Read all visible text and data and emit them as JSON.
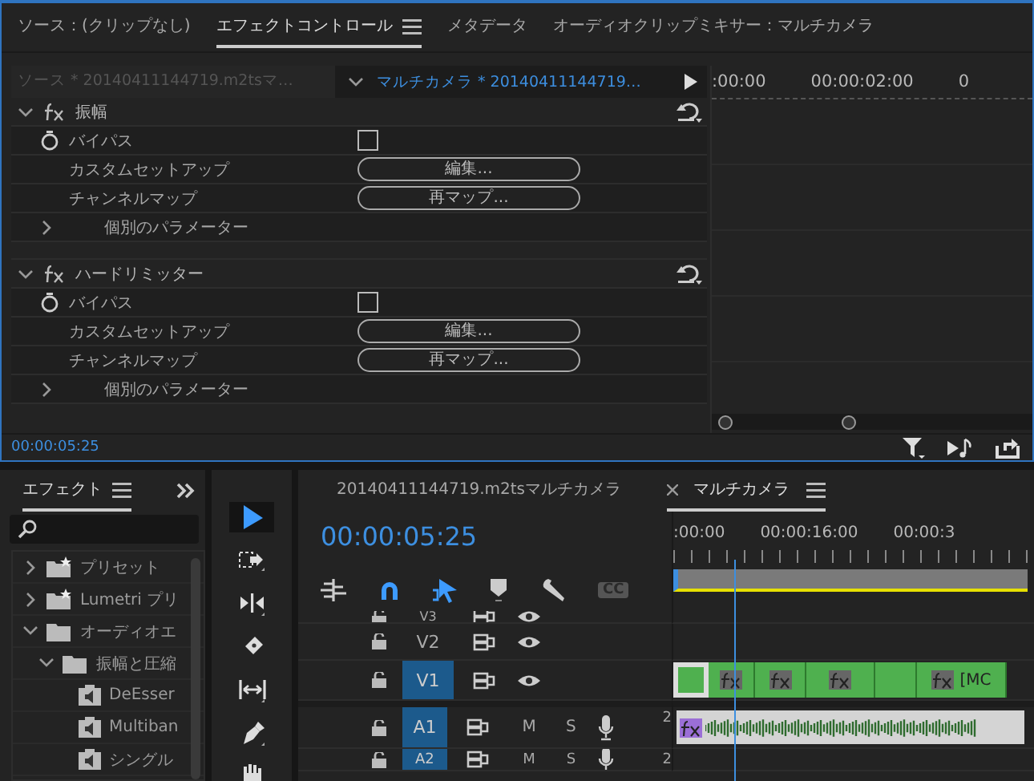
{
  "effect_controls_panel": {
    "tabs": [
      {
        "label": "ソース：(クリップなし)",
        "selected": false,
        "menu": false
      },
      {
        "label": "エフェクトコントロール",
        "selected": true,
        "menu": true
      },
      {
        "label": "メタデータ",
        "selected": false,
        "menu": false
      },
      {
        "label": "オーディオクリップミキサー：マルチカメラ",
        "selected": false,
        "menu": false
      }
    ],
    "source_clip": "ソース * 20140411144719.m2tsマ…",
    "sequence_clip": "マルチカメラ * 20140411144719…",
    "effects": [
      {
        "name": "振幅",
        "expanded": true,
        "parameters": [
          {
            "kind": "checkbox",
            "label": "バイパス",
            "checked": false
          },
          {
            "kind": "button",
            "label": "カスタムセットアップ",
            "button": "編集..."
          },
          {
            "kind": "button",
            "label": "チャンネルマップ",
            "button": "再マップ..."
          },
          {
            "kind": "group",
            "label": "個別のパラメーター",
            "expanded": false
          }
        ]
      },
      {
        "name": "ハードリミッター",
        "expanded": true,
        "parameters": [
          {
            "kind": "checkbox",
            "label": "バイパス",
            "checked": false
          },
          {
            "kind": "button",
            "label": "カスタムセットアップ",
            "button": "編集..."
          },
          {
            "kind": "button",
            "label": "チャンネルマップ",
            "button": "再マップ..."
          },
          {
            "kind": "group",
            "label": "個別のパラメーター",
            "expanded": false
          }
        ]
      }
    ],
    "ruler_labels": [
      ":00:00",
      "00:00:02:00",
      "0"
    ],
    "timecode": "00:00:05:25"
  },
  "effects_panel": {
    "tab": "エフェクト",
    "items": [
      {
        "kind": "preset-folder",
        "label": "プリセット",
        "expanded": false
      },
      {
        "kind": "preset-folder",
        "label": "Lumetri プリ",
        "expanded": false
      },
      {
        "kind": "folder",
        "label": "オーディオエ",
        "expanded": true,
        "children": [
          {
            "kind": "folder",
            "label": "振幅と圧縮",
            "expanded": true,
            "children": [
              {
                "kind": "effect",
                "label": "DeEsser"
              },
              {
                "kind": "effect",
                "label": "Multiban"
              },
              {
                "kind": "effect",
                "label": "シングル"
              }
            ]
          }
        ]
      }
    ]
  },
  "tools": [
    {
      "kind": "selection",
      "selected": true
    },
    {
      "kind": "track-select",
      "selected": false
    },
    {
      "kind": "ripple",
      "selected": false
    },
    {
      "kind": "razor",
      "selected": false
    },
    {
      "kind": "slip",
      "selected": false
    },
    {
      "kind": "pen",
      "selected": false
    },
    {
      "kind": "hand",
      "selected": false
    }
  ],
  "sequence_panel": {
    "tabs": [
      {
        "label": "20140411144719.m2tsマルチカメラ",
        "selected": false,
        "closable": false,
        "menu": false
      },
      {
        "label": "マルチカメラ",
        "selected": true,
        "closable": true,
        "menu": true
      }
    ],
    "timecode": "00:00:05:25",
    "snap": true,
    "linked_selection": true,
    "captions_label": "CC",
    "ruler_labels": [
      ":00:00",
      "00:00:16:00",
      "00:00:3"
    ],
    "tracks": [
      {
        "name": "V3",
        "kind": "video",
        "targeted": false
      },
      {
        "name": "V2",
        "kind": "video",
        "targeted": false
      },
      {
        "name": "V1",
        "kind": "video",
        "targeted": true,
        "clips": [
          {
            "fx": false
          },
          {
            "fx": true
          },
          {
            "fx": true
          },
          {
            "fx": true
          },
          {
            "fx": false
          },
          {
            "fx": true,
            "label": "[MC"
          }
        ]
      },
      {
        "name": "A1",
        "kind": "audio",
        "targeted": true,
        "mute": "M",
        "solo": "S",
        "channels": "2",
        "clips": [
          {
            "fx": true
          }
        ]
      },
      {
        "name": "A2",
        "kind": "audio",
        "targeted": true,
        "mute": "M",
        "solo": "S",
        "channels": "2"
      }
    ]
  }
}
